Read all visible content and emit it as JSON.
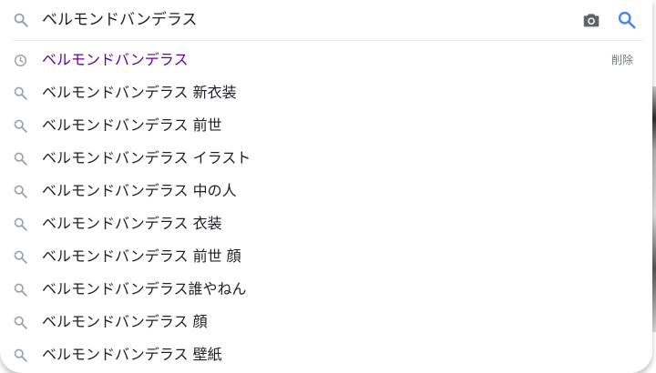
{
  "search": {
    "query": "ベルモンドバンデラス"
  },
  "colors": {
    "history_text": "#660099",
    "text": "#202124",
    "icon_gray": "#9aa0a6",
    "accent_blue": "#4285f4",
    "camera_gray": "#5f6368"
  },
  "suggestions": [
    {
      "text": "ベルモンドバンデラス",
      "type": "history",
      "icon": "clock-icon",
      "action": "削除"
    },
    {
      "text": "ベルモンドバンデラス 新衣装",
      "type": "search",
      "icon": "search-icon"
    },
    {
      "text": "ベルモンドバンデラス 前世",
      "type": "search",
      "icon": "search-icon"
    },
    {
      "text": "ベルモンドバンデラス イラスト",
      "type": "search",
      "icon": "search-icon"
    },
    {
      "text": "ベルモンドバンデラス 中の人",
      "type": "search",
      "icon": "search-icon"
    },
    {
      "text": "ベルモンドバンデラス 衣装",
      "type": "search",
      "icon": "search-icon"
    },
    {
      "text": "ベルモンドバンデラス 前世 顔",
      "type": "search",
      "icon": "search-icon"
    },
    {
      "text": "ベルモンドバンデラス誰やねん",
      "type": "search",
      "icon": "search-icon"
    },
    {
      "text": "ベルモンドバンデラス 顔",
      "type": "search",
      "icon": "search-icon"
    },
    {
      "text": "ベルモンドバンデラス 壁紙",
      "type": "search",
      "icon": "search-icon"
    }
  ]
}
